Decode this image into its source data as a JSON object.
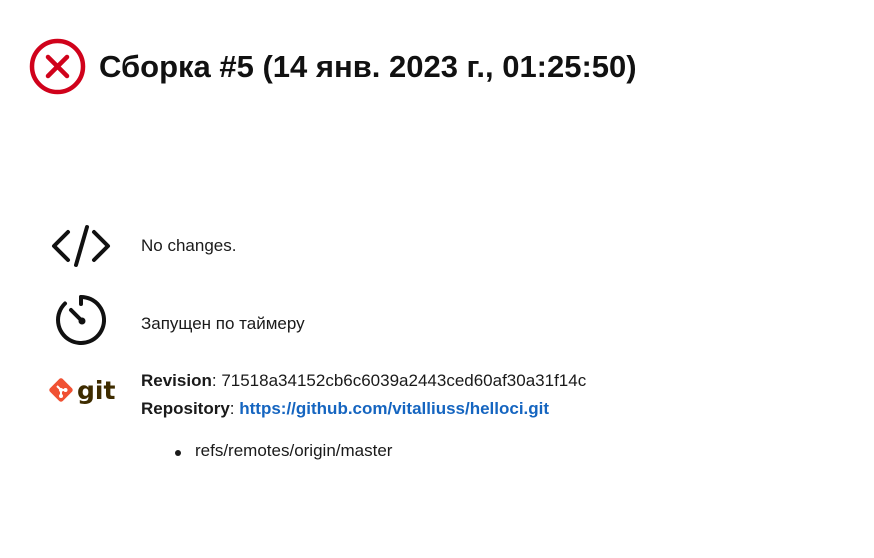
{
  "header": {
    "title": "Сборка #5 (14 янв. 2023 г., 01:25:50)",
    "status": "failed",
    "status_icon": "failed-x-icon",
    "status_color": "#d0021b"
  },
  "summary": {
    "changes": {
      "icon": "code-icon",
      "text": "No changes."
    },
    "trigger": {
      "icon": "timer-icon",
      "text": "Запущен по таймеру"
    },
    "git": {
      "icon": "git-logo-icon",
      "logo_text": "git",
      "logo_color": "#f05133",
      "revision_label": "Revision",
      "revision_value": "71518a34152cb6c6039a2443ced60af30a31f14c",
      "repository_label": "Repository",
      "repository_url": "https://github.com/vitalliuss/helloci.git",
      "refs": [
        "refs/remotes/origin/master"
      ]
    }
  }
}
